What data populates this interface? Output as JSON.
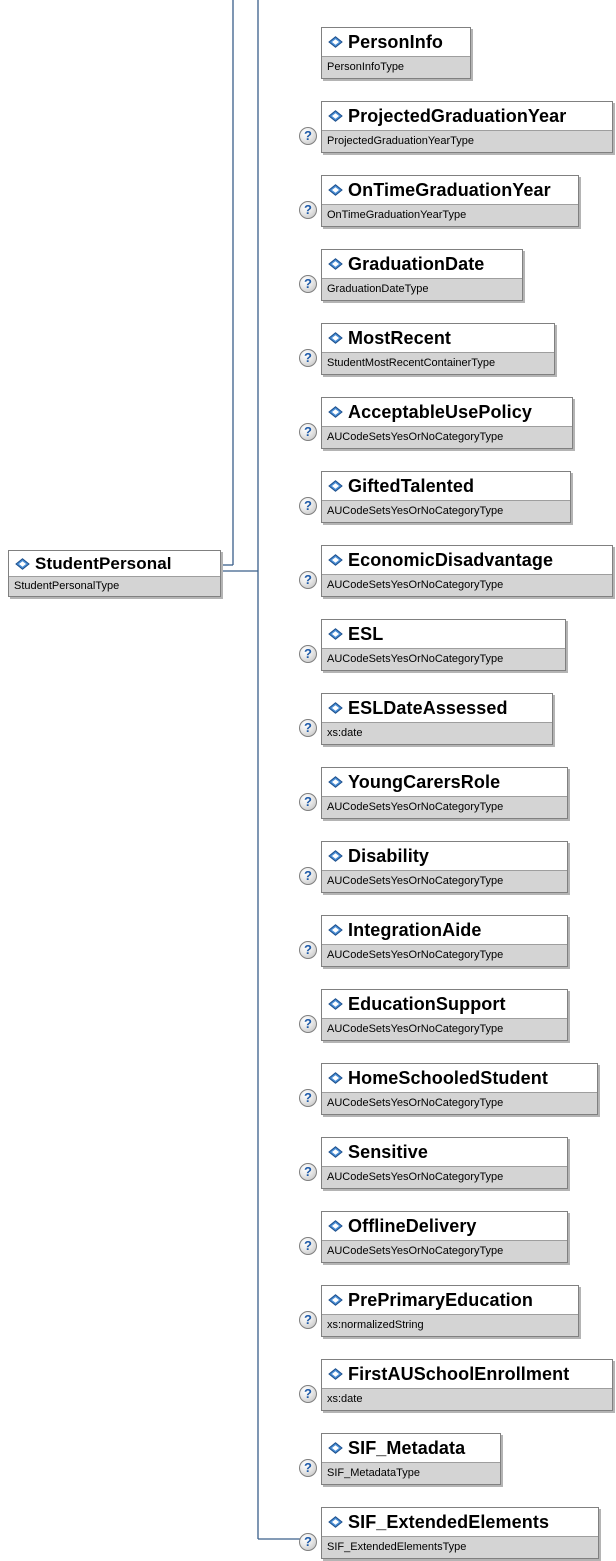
{
  "root": {
    "name": "StudentPersonal",
    "type": "StudentPersonalType"
  },
  "help_glyph": "?",
  "elements": [
    {
      "name": "PersonInfo",
      "type": "PersonInfoType",
      "help": false
    },
    {
      "name": "ProjectedGraduationYear",
      "type": "ProjectedGraduationYearType",
      "help": true
    },
    {
      "name": "OnTimeGraduationYear",
      "type": "OnTimeGraduationYearType",
      "help": true
    },
    {
      "name": "GraduationDate",
      "type": "GraduationDateType",
      "help": true
    },
    {
      "name": "MostRecent",
      "type": "StudentMostRecentContainerType",
      "help": true
    },
    {
      "name": "AcceptableUsePolicy",
      "type": "AUCodeSetsYesOrNoCategoryType",
      "help": true
    },
    {
      "name": "GiftedTalented",
      "type": "AUCodeSetsYesOrNoCategoryType",
      "help": true
    },
    {
      "name": "EconomicDisadvantage",
      "type": "AUCodeSetsYesOrNoCategoryType",
      "help": true
    },
    {
      "name": "ESL",
      "type": "AUCodeSetsYesOrNoCategoryType",
      "help": true
    },
    {
      "name": "ESLDateAssessed",
      "type": "xs:date",
      "help": true
    },
    {
      "name": "YoungCarersRole",
      "type": "AUCodeSetsYesOrNoCategoryType",
      "help": true
    },
    {
      "name": "Disability",
      "type": "AUCodeSetsYesOrNoCategoryType",
      "help": true
    },
    {
      "name": "IntegrationAide",
      "type": "AUCodeSetsYesOrNoCategoryType",
      "help": true
    },
    {
      "name": "EducationSupport",
      "type": "AUCodeSetsYesOrNoCategoryType",
      "help": true
    },
    {
      "name": "HomeSchooledStudent",
      "type": "AUCodeSetsYesOrNoCategoryType",
      "help": true
    },
    {
      "name": "Sensitive",
      "type": "AUCodeSetsYesOrNoCategoryType",
      "help": true
    },
    {
      "name": "OfflineDelivery",
      "type": "AUCodeSetsYesOrNoCategoryType",
      "help": true
    },
    {
      "name": "PrePrimaryEducation",
      "type": "xs:normalizedString",
      "help": true
    },
    {
      "name": "FirstAUSchoolEnrollment",
      "type": "xs:date",
      "help": true
    },
    {
      "name": "SIF_Metadata",
      "type": "SIF_MetadataType",
      "help": true
    },
    {
      "name": "SIF_ExtendedElements",
      "type": "SIF_ExtendedElementsType",
      "help": true
    }
  ],
  "colors": {
    "icon_fill": "#4a8fd6",
    "icon_outline": "#1c4f8c",
    "type_band": "#d4d4d4",
    "connector": "#3a5f8a"
  }
}
